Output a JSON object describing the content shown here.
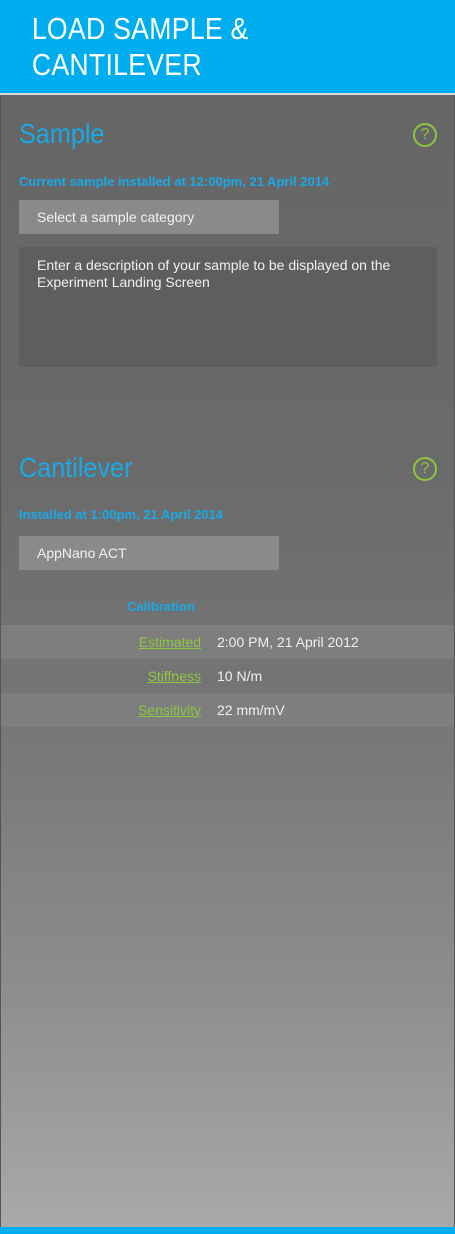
{
  "header": {
    "title": "LOAD SAMPLE & CANTILEVER"
  },
  "sample": {
    "title": "Sample",
    "help_glyph": "?",
    "installed_text": "Current sample installed at 12:00pm, 21 April 2014",
    "category_select": "Select a sample category",
    "description_placeholder": "Enter a description of your sample to be displayed on the Experiment Landing Screen"
  },
  "cantilever": {
    "title": "Cantilever",
    "help_glyph": "?",
    "installed_text": "Installed at 1:00pm, 21 April 2014",
    "model_select": "AppNano ACT"
  },
  "calibration": {
    "heading": "Calibration",
    "rows": [
      {
        "label": "Estimated",
        "value": "2:00 PM, 21 April 2012"
      },
      {
        "label": "Stiffness",
        "value": "10 N/m"
      },
      {
        "label": "Sensitivity",
        "value": "22 mm/mV"
      }
    ]
  },
  "colors": {
    "accent_blue": "#00adef",
    "accent_green": "#8dc63f"
  }
}
